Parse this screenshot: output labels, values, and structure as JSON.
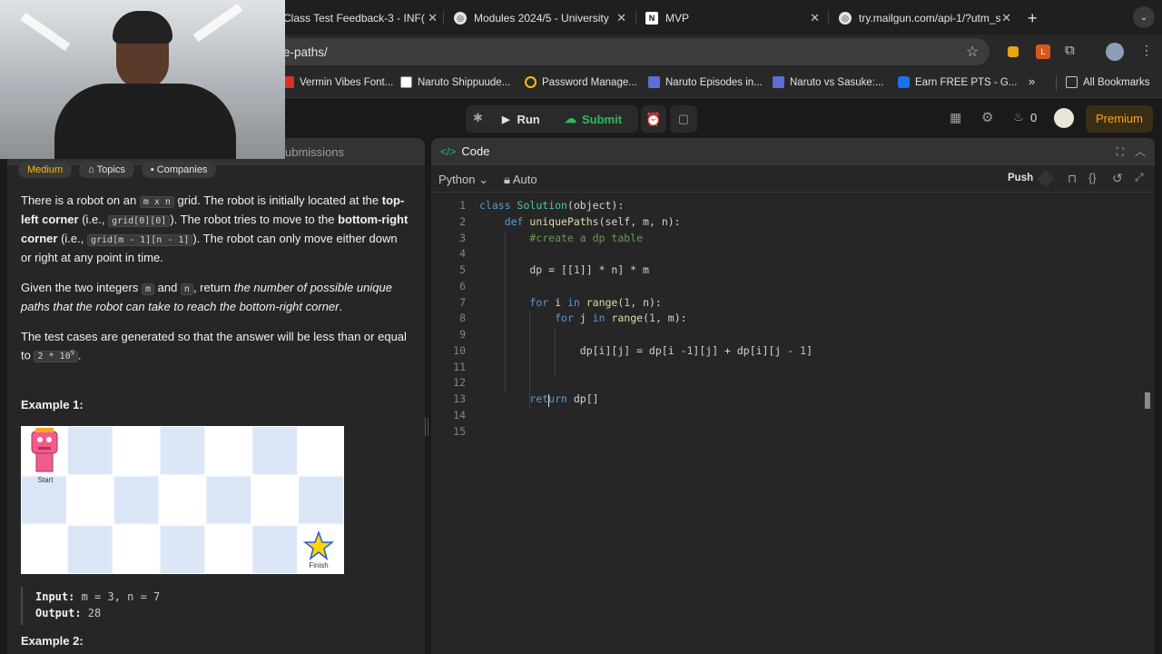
{
  "browser": {
    "tabs": [
      {
        "title": "Class Test Feedback-3 - INF("
      },
      {
        "title": "Modules 2024/5 - University"
      },
      {
        "title": "MVP"
      },
      {
        "title": "try.mailgun.com/api-1/?utm_s"
      }
    ],
    "new_tab": "+",
    "url": "e-paths/",
    "bookmarks": [
      "Vermin Vibes Font...",
      "Naruto Shippuude...",
      "Password Manage...",
      "Naruto Episodes in...",
      "Naruto vs Sasuke:...",
      "Earn FREE PTS - G..."
    ],
    "more_bookmarks": "»",
    "all_bookmarks": "All Bookmarks"
  },
  "toolbar": {
    "run": "Run",
    "submit": "Submit",
    "streak": "0",
    "premium": "Premium"
  },
  "left": {
    "tab_submissions": "ubmissions",
    "difficulty": "Medium",
    "topics": "Topics",
    "companies": "Companies",
    "p1": {
      "a": "There is a robot on an ",
      "mxn": "m x n",
      "b": " grid. The robot is initially located at the ",
      "top_left": "top-left corner",
      "c": " (i.e., ",
      "g00": "grid[0][0]",
      "d": "). The robot tries to move to the ",
      "bottom_right": "bottom-right corner",
      "e": " (i.e., ",
      "gmn": "grid[m - 1][n - 1]",
      "f": "). The robot can only move either down or right at any point in time."
    },
    "p2": {
      "a": "Given the two integers ",
      "m": "m",
      "and": " and ",
      "n": "n",
      "b": ", return ",
      "em": "the number of possible unique paths that the robot can take to reach the bottom-right corner",
      "c": "."
    },
    "p3": {
      "a": "The test cases are generated so that the answer will be less than or equal to ",
      "val": "2 * 10",
      "exp": "9",
      "b": "."
    },
    "example1_title": "Example 1:",
    "grid_start": "Start",
    "grid_finish": "Finish",
    "input_label": "Input:",
    "input_value": " m = 3, n = 7",
    "output_label": "Output:",
    "output_value": " 28",
    "example2_title": "Example 2:"
  },
  "editor": {
    "title": "Code",
    "language": "Python",
    "auto": "Auto",
    "push": "Push",
    "line_numbers": [
      "1",
      "2",
      "3",
      "4",
      "5",
      "6",
      "7",
      "8",
      "9",
      "10",
      "11",
      "12",
      "13",
      "14",
      "15"
    ],
    "lines": [
      [
        [
          "kw",
          "class "
        ],
        [
          "cls",
          "Solution"
        ],
        [
          "",
          "(object):"
        ]
      ],
      [
        [
          "",
          "    "
        ],
        [
          "kw",
          "def "
        ],
        [
          "fn",
          "uniquePaths"
        ],
        [
          "",
          "(self, m, n):"
        ]
      ],
      [
        [
          "",
          "        "
        ],
        [
          "cm",
          "#create a dp table"
        ]
      ],
      [
        [
          "",
          ""
        ]
      ],
      [
        [
          "",
          "        dp = [["
        ],
        [
          "nm",
          "1"
        ],
        [
          "",
          "]] * n] * m"
        ]
      ],
      [
        [
          "",
          ""
        ]
      ],
      [
        [
          "",
          "        "
        ],
        [
          "kw",
          "for "
        ],
        [
          "",
          "i "
        ],
        [
          "kw",
          "in "
        ],
        [
          "fn",
          "range"
        ],
        [
          "",
          "("
        ],
        [
          "nm",
          "1"
        ],
        [
          "",
          ", n):"
        ]
      ],
      [
        [
          "",
          "            "
        ],
        [
          "kw",
          "for "
        ],
        [
          "",
          "j "
        ],
        [
          "kw",
          "in "
        ],
        [
          "fn",
          "range"
        ],
        [
          "",
          "("
        ],
        [
          "nm",
          "1"
        ],
        [
          "",
          ", m):"
        ]
      ],
      [
        [
          "",
          ""
        ]
      ],
      [
        [
          "",
          "                dp[i][j] = dp[i -"
        ],
        [
          "nm",
          "1"
        ],
        [
          "",
          "][j] + dp[i][j - "
        ],
        [
          "nm",
          "1"
        ],
        [
          "",
          "]"
        ]
      ],
      [
        [
          "",
          ""
        ]
      ],
      [
        [
          "",
          ""
        ]
      ],
      [
        [
          "",
          "        "
        ],
        [
          "kw",
          "return "
        ],
        [
          "",
          "dp[]"
        ]
      ],
      [
        [
          "",
          ""
        ]
      ],
      [
        [
          "",
          ""
        ]
      ]
    ]
  },
  "colors": {
    "accent_green": "#2cbb5d",
    "medium": "#ffb800",
    "premium": "#ffa116",
    "grid_light": "#dbe7f7"
  }
}
